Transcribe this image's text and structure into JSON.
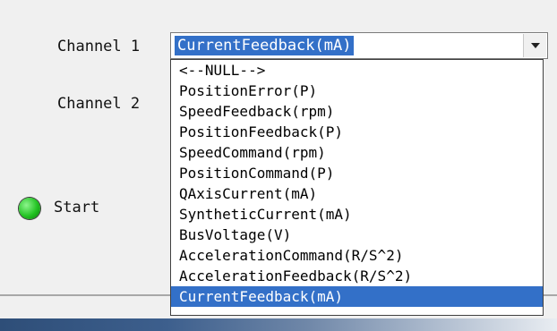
{
  "channel1": {
    "label": "Channel 1",
    "selected_value": "CurrentFeedback(mA)"
  },
  "channel2": {
    "label": "Channel 2"
  },
  "start": {
    "label": "Start",
    "indicator_color": "#23c323"
  },
  "dropdown": {
    "options": [
      "<--NULL-->",
      "PositionError(P)",
      "SpeedFeedback(rpm)",
      "PositionFeedback(P)",
      "SpeedCommand(rpm)",
      "PositionCommand(P)",
      "QAxisCurrent(mA)",
      "SyntheticCurrent(mA)",
      "BusVoltage(V)",
      "AccelerationCommand(R/S^2)",
      "AccelerationFeedback(R/S^2)",
      "CurrentFeedback(mA)"
    ],
    "selected_index": 11
  },
  "colors": {
    "selection": "#3370c8"
  },
  "icons": {
    "combo_arrow": "chevron-down-icon",
    "status": "status-led-icon"
  }
}
